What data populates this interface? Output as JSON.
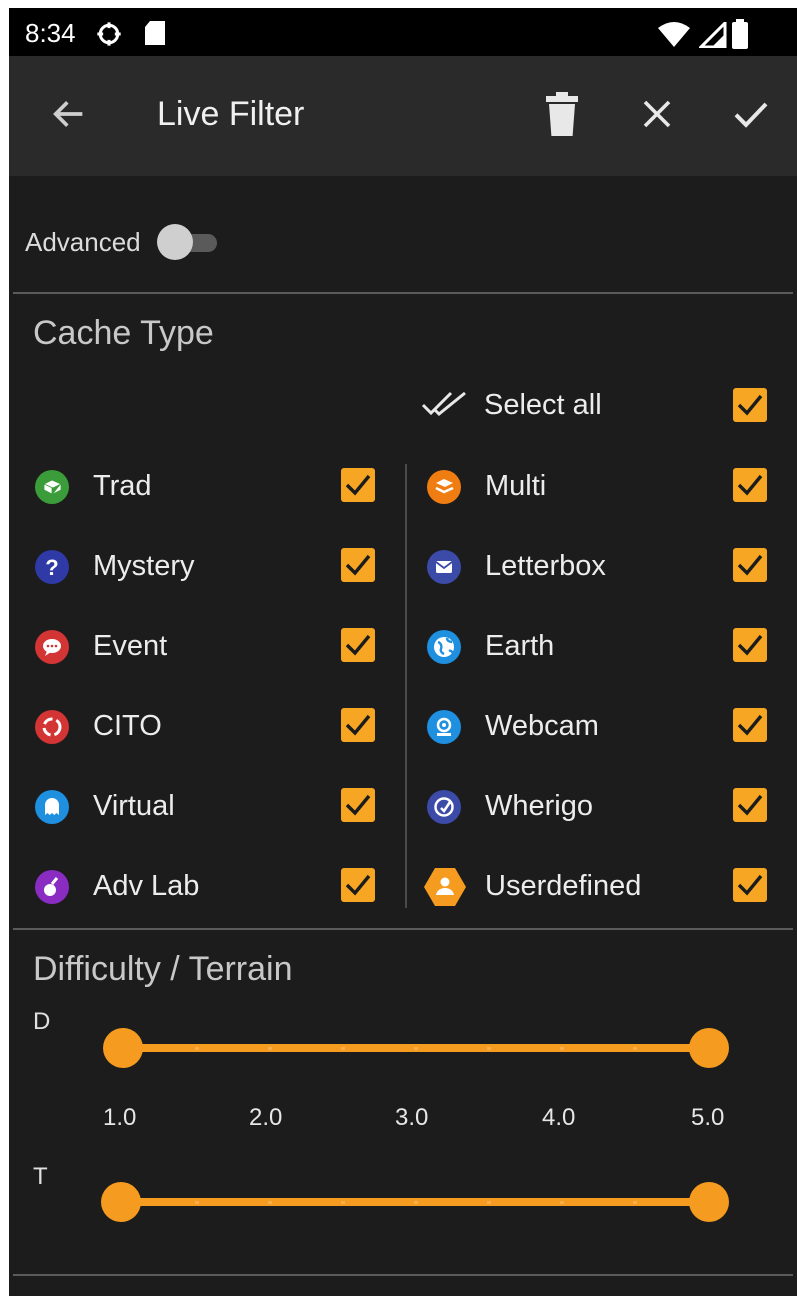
{
  "status_bar": {
    "time": "8:34"
  },
  "toolbar": {
    "title": "Live Filter"
  },
  "advanced": {
    "label": "Advanced",
    "enabled": false
  },
  "cache_type": {
    "title": "Cache Type",
    "select_all": {
      "label": "Select all",
      "checked": true
    },
    "left": [
      {
        "label": "Trad",
        "icon": "trad-icon",
        "color": "#3a9d3a",
        "checked": true
      },
      {
        "label": "Mystery",
        "icon": "mystery-icon",
        "color": "#2f3aa6",
        "checked": true
      },
      {
        "label": "Event",
        "icon": "event-icon",
        "color": "#d33434",
        "checked": true
      },
      {
        "label": "CITO",
        "icon": "cito-icon",
        "color": "#d33434",
        "checked": true
      },
      {
        "label": "Virtual",
        "icon": "virtual-icon",
        "color": "#1f8fe0",
        "checked": true
      },
      {
        "label": "Adv Lab",
        "icon": "adv-lab-icon",
        "color": "#8a2bc2",
        "checked": true
      }
    ],
    "right": [
      {
        "label": "Multi",
        "icon": "multi-icon",
        "color": "#f07d12",
        "checked": true
      },
      {
        "label": "Letterbox",
        "icon": "letterbox-icon",
        "color": "#3c4aa8",
        "checked": true
      },
      {
        "label": "Earth",
        "icon": "earth-icon",
        "color": "#1f8fe0",
        "checked": true
      },
      {
        "label": "Webcam",
        "icon": "webcam-icon",
        "color": "#1f8fe0",
        "checked": true
      },
      {
        "label": "Wherigo",
        "icon": "wherigo-icon",
        "color": "#3c4aa8",
        "checked": true
      },
      {
        "label": "Userdefined",
        "icon": "userdefined-icon",
        "color": "#f59b1f",
        "checked": true
      }
    ]
  },
  "difficulty_terrain": {
    "title": "Difficulty / Terrain",
    "d_label": "D",
    "t_label": "T",
    "ticks": [
      "1.0",
      "2.0",
      "3.0",
      "4.0",
      "5.0"
    ],
    "difficulty_range": [
      1.0,
      5.0
    ],
    "terrain_range": [
      1.0,
      5.0
    ]
  },
  "colors": {
    "accent": "#f59b1f",
    "checkbox": "#f6a623",
    "background": "#1c1c1c",
    "toolbar": "#2a2a2a"
  }
}
